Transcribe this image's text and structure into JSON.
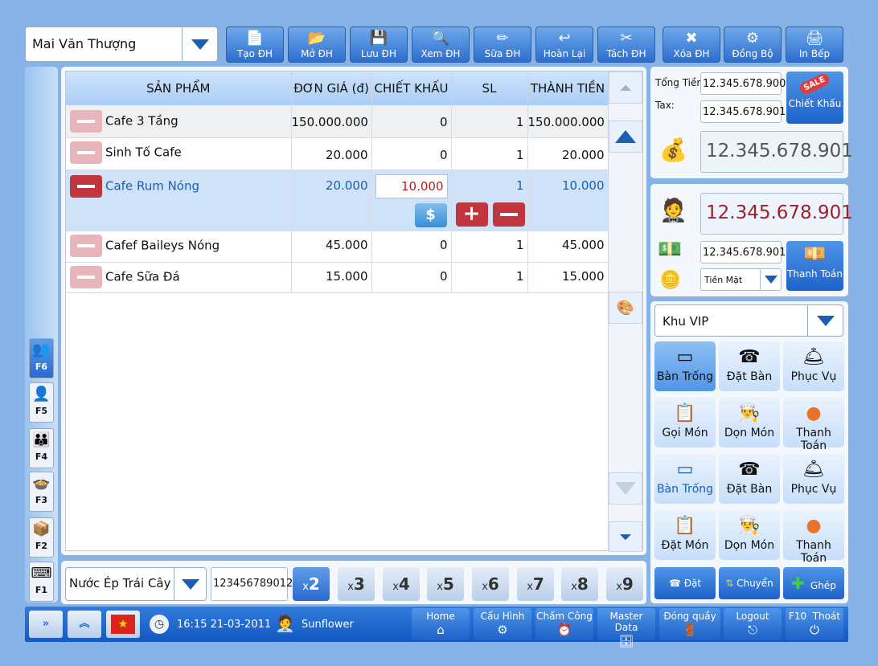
{
  "customer_select": {
    "value": "Mai Văn Thượng"
  },
  "toolbar": [
    {
      "label": "Tạo ĐH",
      "icon": "new-order-icon"
    },
    {
      "label": "Mở ĐH",
      "icon": "open-order-icon"
    },
    {
      "label": "Lưu ĐH",
      "icon": "save-icon"
    },
    {
      "label": "Xem ĐH",
      "icon": "view-icon"
    },
    {
      "label": "Sữa ĐH",
      "icon": "edit-icon"
    },
    {
      "label": "Hoàn Lại",
      "icon": "refund-icon"
    },
    {
      "label": "Tách ĐH",
      "icon": "split-icon"
    },
    {
      "label": "Xóa ĐH",
      "icon": "delete-icon"
    },
    {
      "label": "Đồng Bộ",
      "icon": "sync-icon"
    },
    {
      "label": "In Bếp",
      "icon": "print-icon"
    }
  ],
  "table": {
    "headers": [
      "SẢN PHẨM",
      "ĐƠN GIÁ (đ)",
      "CHIẾT KHẤU",
      "SL",
      "THÀNH TIỀN"
    ],
    "rows": [
      {
        "name": "Cafe 3 Tầng",
        "price": "150.000.000",
        "discount": "0",
        "qty": "1",
        "total": "150.000.000"
      },
      {
        "name": "Sinh Tố Cafe",
        "price": "20.000",
        "discount": "0",
        "qty": "1",
        "total": "20.000"
      },
      {
        "name": "Cafe Rum Nóng",
        "price": "20.000",
        "discount": "10.000",
        "qty": "1",
        "total": "10.000"
      },
      {
        "name": "Cafef Baileys Nóng",
        "price": "45.000",
        "discount": "0",
        "qty": "1",
        "total": "45.000"
      },
      {
        "name": "Cafe Sữa Đá",
        "price": "15.000",
        "discount": "0",
        "qty": "1",
        "total": "15.000"
      }
    ]
  },
  "summary": {
    "total_label": "Tổng Tiền",
    "total_value": "12.345.678.900",
    "tax_label": "Tax:",
    "tax_value": "12.345.678.901",
    "discount_button": "Chiết Khấu",
    "sale_badge": "SALE",
    "grand_total": "12.345.678.901",
    "customer_pay": "12.345.678.901",
    "cash_value": "12.345.678.901",
    "payment_method": "Tiền Mặt",
    "pay_button": "Thanh Toán"
  },
  "area_select": {
    "value": "Khu VIP"
  },
  "tables": [
    {
      "label": "Bàn Trống",
      "icon": "empty-table-icon",
      "state": "active"
    },
    {
      "label": "Đặt Bàn",
      "icon": "phone-icon"
    },
    {
      "label": "Phục Vụ",
      "icon": "waiter-icon"
    },
    {
      "label": "Gọi Món",
      "icon": "menu-icon"
    },
    {
      "label": "Dọn Món",
      "icon": "chef-icon"
    },
    {
      "label": "Thanh Toán",
      "icon": "dollar-icon"
    },
    {
      "label": "Bàn Trống",
      "icon": "empty-table-icon"
    },
    {
      "label": "Đặt Bàn",
      "icon": "phone-icon"
    },
    {
      "label": "Phục Vụ",
      "icon": "waiter-icon"
    },
    {
      "label": "Đặt Món",
      "icon": "menu-icon"
    },
    {
      "label": "Dọn Món",
      "icon": "chef-icon"
    },
    {
      "label": "Thanh Toán",
      "icon": "dollar-icon"
    }
  ],
  "table_actions": [
    {
      "label": "Đặt",
      "icon": "phone-icon"
    },
    {
      "label": "Chuyển",
      "icon": "transfer-icon"
    },
    {
      "label": "Ghép",
      "icon": "plus-icon"
    }
  ],
  "fkeys": [
    "F6",
    "F5",
    "F4",
    "F3",
    "F2",
    "F1"
  ],
  "product_select": {
    "value": "Nước Ép Trái Cây"
  },
  "barcode": {
    "value": "123456789012"
  },
  "multipliers": [
    {
      "x": "x",
      "n": "2"
    },
    {
      "x": "x",
      "n": "3"
    },
    {
      "x": "x",
      "n": "4"
    },
    {
      "x": "x",
      "n": "5"
    },
    {
      "x": "x",
      "n": "6"
    },
    {
      "x": "x",
      "n": "7"
    },
    {
      "x": "x",
      "n": "8"
    },
    {
      "x": "x",
      "n": "9"
    }
  ],
  "status": {
    "time": "16:15 21-03-2011",
    "user": "Sunflower"
  },
  "bottom_nav": [
    {
      "label": "Home",
      "icon": "home-icon"
    },
    {
      "label": "Cấu Hình",
      "icon": "config-icon"
    },
    {
      "label": "Chấm Công",
      "icon": "clock-icon"
    },
    {
      "label": "Master Data",
      "icon": "database-icon"
    },
    {
      "label": "Đóng quầy",
      "icon": "close-counter-icon"
    },
    {
      "label": "Logout",
      "icon": "logout-icon"
    },
    {
      "label": "F10  Thoát",
      "icon": "power-icon"
    }
  ]
}
